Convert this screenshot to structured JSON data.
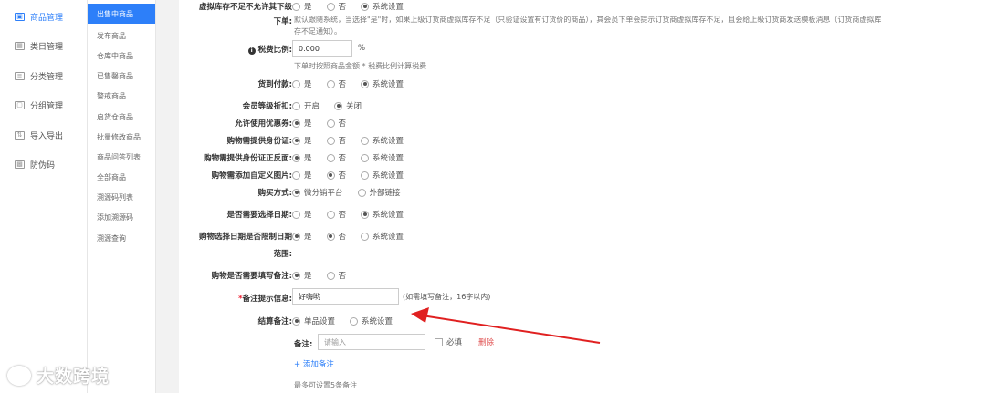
{
  "left_nav": {
    "items": [
      {
        "label": "商品管理",
        "icon": "product-icon",
        "active": true
      },
      {
        "label": "类目管理",
        "icon": "category-icon"
      },
      {
        "label": "分类管理",
        "icon": "classify-icon"
      },
      {
        "label": "分组管理",
        "icon": "group-icon"
      },
      {
        "label": "导入导出",
        "icon": "import-export-icon"
      },
      {
        "label": "防伪码",
        "icon": "anti-fake-icon"
      }
    ]
  },
  "sub_nav": {
    "items": [
      "出售中商品",
      "发布商品",
      "仓库中商品",
      "已售罄商品",
      "警戒商品",
      "启货仓商品",
      "批量修改商品",
      "商品问答列表",
      "全部商品",
      "溯源码列表",
      "添加溯源码",
      "溯源查询"
    ]
  },
  "form": {
    "virtual_stock": {
      "label_line1": "虚拟库存不足不允许其下级",
      "label_line2": "下单:",
      "options": [
        "是",
        "否",
        "系统设置"
      ],
      "desc_line1": "默认跟随系统，当选择\"是\"时，如果上级订货商虚拟库存不足（只验证设置有订货价的商品），其会员下单会提示订货商虚拟库存不足，且会给上级订货商发送模板消息（订货商虚拟库",
      "desc_line2": "存不足通知）。"
    },
    "tax_rate": {
      "label": "税费比例:",
      "value": "0.000",
      "unit": "%",
      "hint": "下单时按照商品金额 * 税费比例计算税费"
    },
    "cod": {
      "label": "货到付款:",
      "options": [
        "是",
        "否",
        "系统设置"
      ]
    },
    "member_discount": {
      "label": "会员等级折扣:",
      "options": [
        "开启",
        "关闭"
      ]
    },
    "allow_coupon": {
      "label": "允许使用优惠券:",
      "options": [
        "是",
        "否"
      ]
    },
    "need_id": {
      "label": "购物需提供身份证:",
      "options": [
        "是",
        "否",
        "系统设置"
      ]
    },
    "need_id_photo": {
      "label": "购物需提供身份证正反面:",
      "options": [
        "是",
        "否",
        "系统设置"
      ]
    },
    "need_custom_image": {
      "label": "购物需添加自定义图片:",
      "options": [
        "是",
        "否",
        "系统设置"
      ]
    },
    "buy_method": {
      "label": "购买方式:",
      "options": [
        "微分销平台",
        "外部链接"
      ]
    },
    "need_date": {
      "label": "是否需要选择日期:",
      "options": [
        "是",
        "否",
        "系统设置"
      ]
    },
    "limit_date_range": {
      "label_line1": "购物选择日期是否限制日期",
      "label_line2": "范围:",
      "options": [
        "是",
        "否",
        "系统设置"
      ]
    },
    "need_remark": {
      "label": "购物是否需要填写备注:",
      "options": [
        "是",
        "否"
      ]
    },
    "remark_hint": {
      "required_mark": "*",
      "label": "备注提示信息:",
      "value": "好嗨哟",
      "hint": "(如需填写备注，16字以内)"
    },
    "settle_remark": {
      "label": "结算备注:",
      "options": [
        "单品设置",
        "系统设置"
      ]
    },
    "remark_item": {
      "label": "备注:",
      "placeholder": "请输入",
      "required_label": "必填",
      "delete_label": "删除"
    },
    "add_remark": "+ 添加备注",
    "max_note": "最多可设置5条备注"
  },
  "watermark": {
    "text": "大数跨境"
  },
  "colors": {
    "accent": "#2d7ff9",
    "arrow": "#e02020",
    "delete": "#e05050"
  }
}
